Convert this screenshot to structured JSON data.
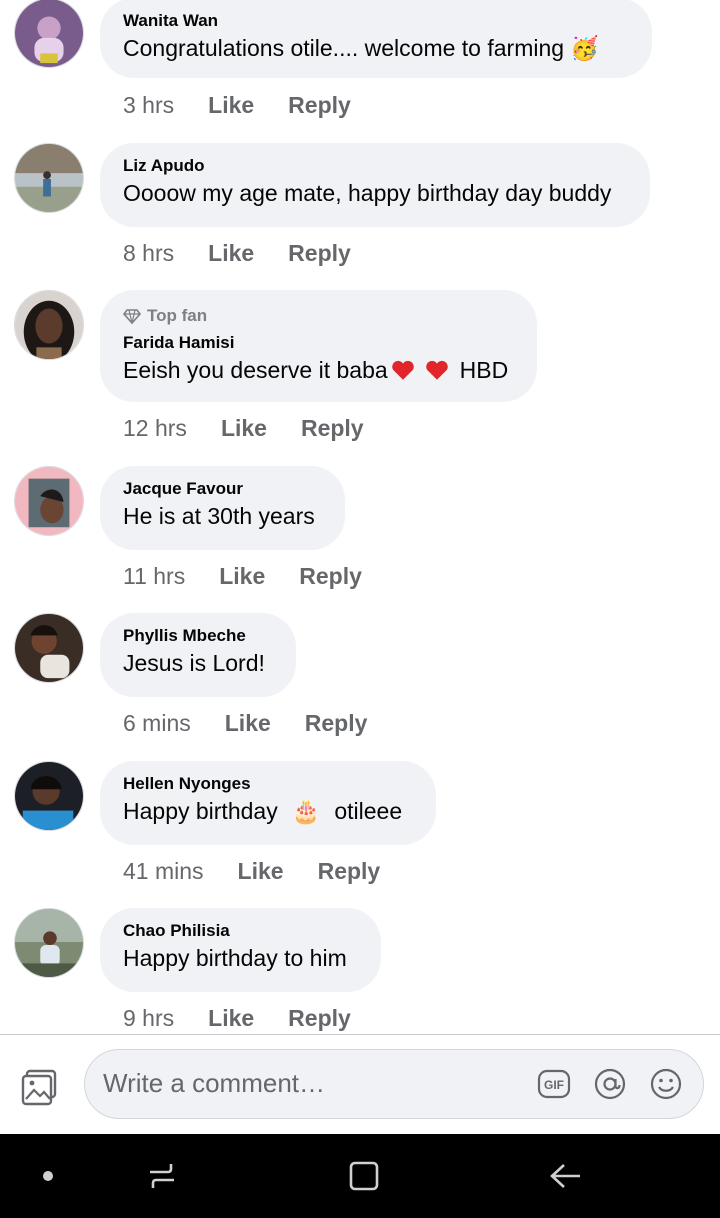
{
  "comments": [
    {
      "author": "Wanita Wan",
      "text": "Congratulations otile.... welcome to farming",
      "emoji": "🥳",
      "time": "3 hrs",
      "like": "Like",
      "reply": "Reply"
    },
    {
      "author": "Liz Apudo",
      "text": "Oooow my age mate, happy birthday day buddy",
      "time": "8 hrs",
      "like": "Like",
      "reply": "Reply"
    },
    {
      "badge": "Top fan",
      "author": "Farida Hamisi",
      "text": "Eeish you deserve it baba",
      "text_after": "HBD",
      "time": "12 hrs",
      "like": "Like",
      "reply": "Reply"
    },
    {
      "author": "Jacque Favour",
      "text": "He is at 30th years",
      "time": "11 hrs",
      "like": "Like",
      "reply": "Reply"
    },
    {
      "author": "Phyllis Mbeche",
      "text": "Jesus is Lord!",
      "time": "6 mins",
      "like": "Like",
      "reply": "Reply"
    },
    {
      "author": "Hellen Nyonges",
      "text": "Happy birthday",
      "emoji": "🎂",
      "text_after": "otileee",
      "time": "41 mins",
      "like": "Like",
      "reply": "Reply"
    },
    {
      "author": "Chao Philisia",
      "text": "Happy birthday to him",
      "time": "9 hrs",
      "like": "Like",
      "reply": "Reply"
    }
  ],
  "composer": {
    "placeholder": "Write a comment…",
    "gif": "GIF"
  },
  "icons": {
    "photo": "photo-icon",
    "gif": "gif-icon",
    "mention": "at-icon",
    "emoji": "smiley-icon",
    "nav_dot": "dot-icon",
    "nav_recent": "recents-icon",
    "nav_home": "home-square-icon",
    "nav_back": "back-arrow-icon"
  }
}
